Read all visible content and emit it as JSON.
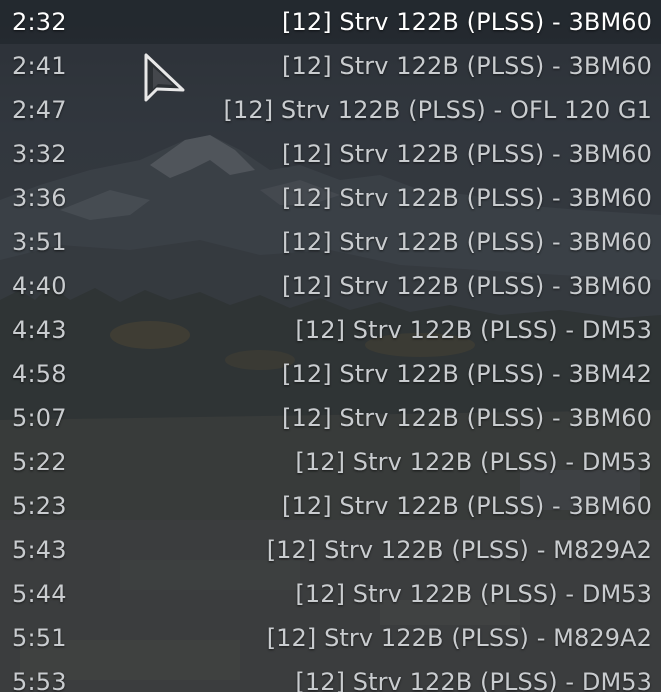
{
  "kill_log": {
    "rows": [
      {
        "time": "2:32",
        "entry": "[12] Strv 122B (PLSS) - 3BM60"
      },
      {
        "time": "2:41",
        "entry": "[12] Strv 122B (PLSS) - 3BM60"
      },
      {
        "time": "2:47",
        "entry": "[12] Strv 122B (PLSS) - OFL 120 G1"
      },
      {
        "time": "3:32",
        "entry": "[12] Strv 122B (PLSS) - 3BM60"
      },
      {
        "time": "3:36",
        "entry": "[12] Strv 122B (PLSS) - 3BM60"
      },
      {
        "time": "3:51",
        "entry": "[12] Strv 122B (PLSS) - 3BM60"
      },
      {
        "time": "4:40",
        "entry": "[12] Strv 122B (PLSS) - 3BM60"
      },
      {
        "time": "4:43",
        "entry": "[12] Strv 122B (PLSS) - DM53"
      },
      {
        "time": "4:58",
        "entry": "[12] Strv 122B (PLSS) - 3BM42"
      },
      {
        "time": "5:07",
        "entry": "[12] Strv 122B (PLSS) - 3BM60"
      },
      {
        "time": "5:22",
        "entry": "[12] Strv 122B (PLSS) - DM53"
      },
      {
        "time": "5:23",
        "entry": "[12] Strv 122B (PLSS) - 3BM60"
      },
      {
        "time": "5:43",
        "entry": "[12] Strv 122B (PLSS) - M829A2"
      },
      {
        "time": "5:44",
        "entry": "[12] Strv 122B (PLSS) - DM53"
      },
      {
        "time": "5:51",
        "entry": "[12] Strv 122B (PLSS) - M829A2"
      },
      {
        "time": "5:53",
        "entry": "[12] Strv 122B (PLSS) - DM53"
      }
    ]
  },
  "icons": {
    "cursor": "mouse-pointer-icon"
  },
  "colors": {
    "text": "#c9cccf",
    "text_highlight": "#ffffff",
    "row_highlight": "#23272d"
  }
}
